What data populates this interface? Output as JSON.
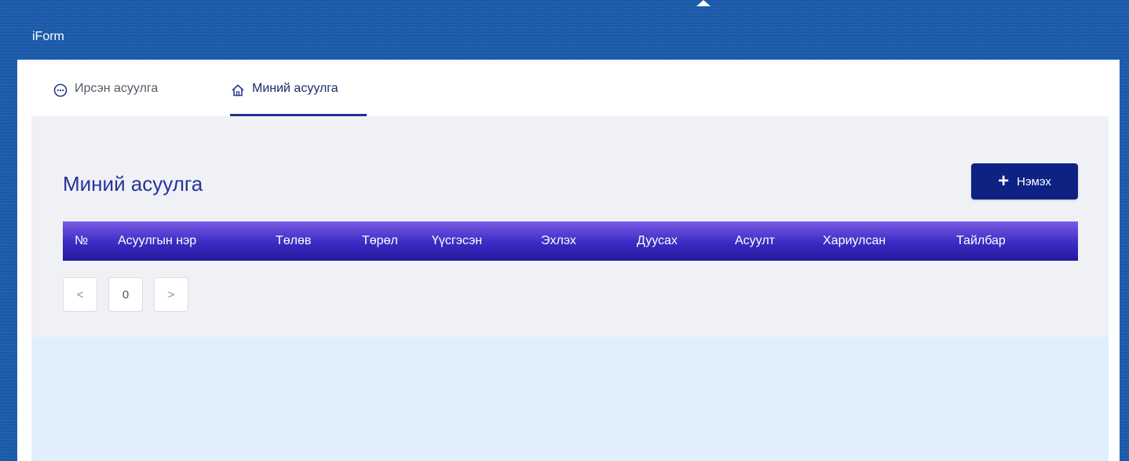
{
  "app": {
    "title": "iForm"
  },
  "tabs": [
    {
      "label": "Ирсэн асуулга",
      "icon": "chat-bubble-icon",
      "active": false
    },
    {
      "label": "Миний асуулга",
      "icon": "home-icon",
      "active": true
    }
  ],
  "main": {
    "title": "Миний асуулга",
    "add_button": {
      "label": "Нэмэх",
      "icon": "plus-icon"
    }
  },
  "table": {
    "columns": [
      "№",
      "Асуулгын нэр",
      "Төлөв",
      "Төрөл",
      "Үүсгэсэн",
      "Эхлэх",
      "Дуусах",
      "Асуулт",
      "Хариулсан",
      "Тайлбар"
    ],
    "rows": []
  },
  "pagination": {
    "prev": "<",
    "page": "0",
    "next": ">"
  },
  "colors": {
    "header_bg": "#1b5aa9",
    "accent": "#0e2283",
    "title": "#26329a",
    "table_header_gradient": [
      "#7a5be3",
      "#23199a"
    ]
  }
}
